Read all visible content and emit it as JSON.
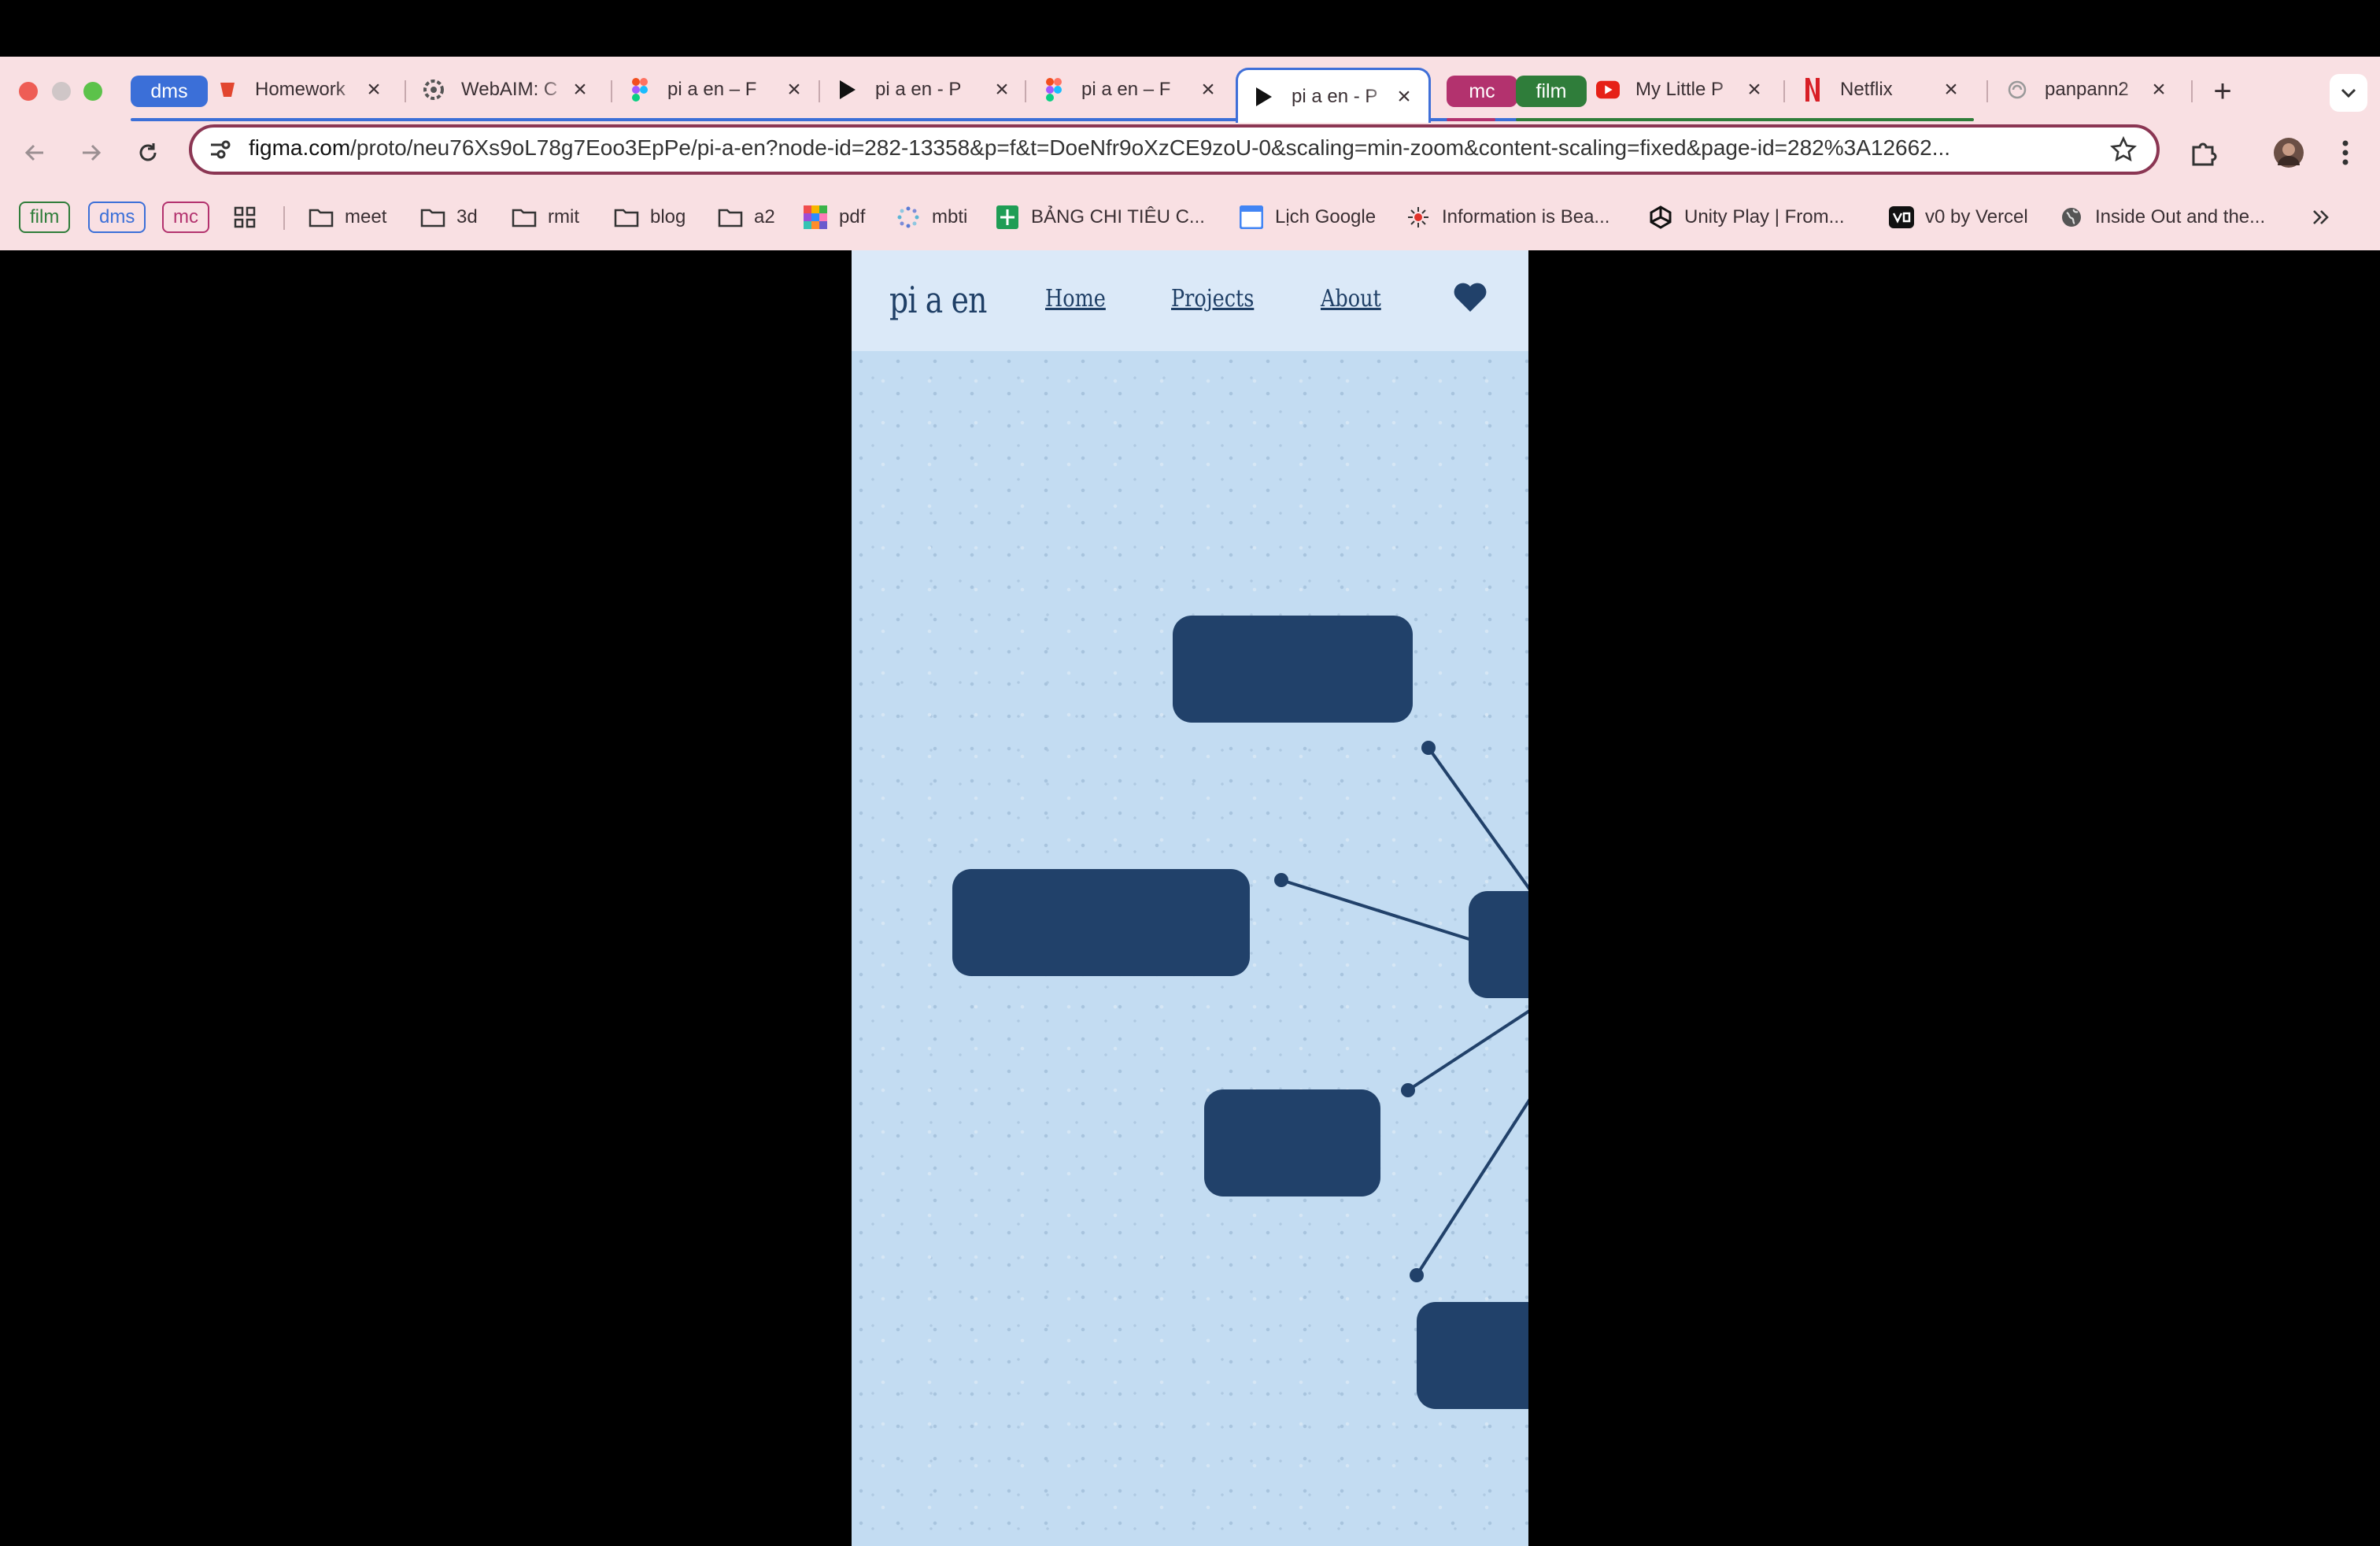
{
  "browser": {
    "tabs": [
      {
        "label": "Homework",
        "icon": "red-app-icon"
      },
      {
        "label": "WebAIM: C",
        "icon": "webaim-icon"
      },
      {
        "label": "pi a en – F",
        "icon": "figma-icon"
      },
      {
        "label": "pi a en - P",
        "icon": "play-icon"
      },
      {
        "label": "pi a en – F",
        "icon": "figma-icon"
      },
      {
        "label": "pi a en - P",
        "icon": "play-icon",
        "active": true
      },
      {
        "label": "My Little P",
        "icon": "youtube-icon"
      },
      {
        "label": "Netflix",
        "icon": "netflix-icon"
      },
      {
        "label": "panpann2",
        "icon": "globe-icon"
      }
    ],
    "tab_groups": [
      {
        "label": "dms",
        "color": "#3b6fd8"
      },
      {
        "label": "mc",
        "color": "#b3326e"
      },
      {
        "label": "film",
        "color": "#2f7d3a"
      }
    ],
    "address_bar": {
      "host": "figma.com",
      "path": "/proto/neu76Xs9oL78g7Eoo3EpPe/pi-a-en?node-id=282-13358&p=f&t=DoeNfr9oXzCE9zoU-0&scaling=min-zoom&content-scaling=fixed&page-id=282%3A12662..."
    },
    "bookmarks": {
      "chips": [
        {
          "label": "film",
          "color": "#2f7d3a"
        },
        {
          "label": "dms",
          "color": "#3b6fd8"
        },
        {
          "label": "mc",
          "color": "#b3326e"
        }
      ],
      "items": [
        {
          "label": "meet",
          "icon": "folder-icon"
        },
        {
          "label": "3d",
          "icon": "folder-icon"
        },
        {
          "label": "rmit",
          "icon": "folder-icon"
        },
        {
          "label": "blog",
          "icon": "folder-icon"
        },
        {
          "label": "a2",
          "icon": "folder-icon"
        },
        {
          "label": "pdf",
          "icon": "colorful-grid-icon"
        },
        {
          "label": "mbti",
          "icon": "dots-circle-icon"
        },
        {
          "label": "BẢNG CHI TIÊU C...",
          "icon": "sheets-icon"
        },
        {
          "label": "Lịch Google",
          "icon": "calendar-icon"
        },
        {
          "label": "Information is Bea...",
          "icon": "sparkle-icon"
        },
        {
          "label": "Unity Play | From...",
          "icon": "unity-icon"
        },
        {
          "label": "v0 by Vercel",
          "icon": "v0-icon"
        },
        {
          "label": "Inside Out and the...",
          "icon": "globe-icon"
        }
      ]
    }
  },
  "site": {
    "logo": "pi a en",
    "nav": {
      "home": "Home",
      "projects": "Projects",
      "about": "About"
    }
  },
  "colors": {
    "nav_bg": "#dbe9f8",
    "canvas_bg": "#c3dcf2",
    "node": "#21416a",
    "omnibox_border": "#8b3653",
    "chrome_bg": "#f9e0e3"
  }
}
